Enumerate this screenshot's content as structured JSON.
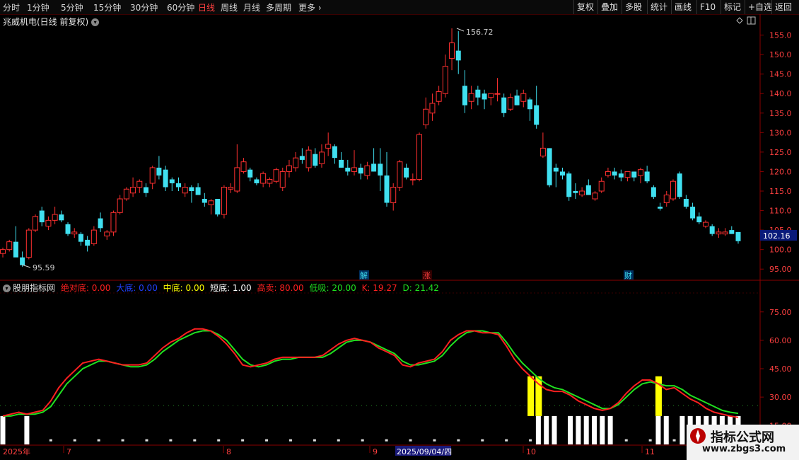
{
  "toolbar": {
    "periods": [
      "分时",
      "1分钟",
      "5分钟",
      "15分钟",
      "30分钟",
      "60分钟",
      "日线",
      "周线",
      "月线",
      "多周期",
      "更多"
    ],
    "active_period": "日线",
    "right_buttons": [
      "复权",
      "叠加",
      "多股",
      "统计",
      "画线",
      "F10",
      "标记",
      "+自选",
      "返回"
    ]
  },
  "stock": {
    "title": "兆威机电(日线 前复权)"
  },
  "price_chart": {
    "y_ticks": [
      "155.0",
      "150.0",
      "145.0",
      "140.0",
      "135.0",
      "130.0",
      "125.0",
      "120.0",
      "115.0",
      "110.0",
      "105.0",
      "100.0",
      "95.00"
    ],
    "y_range": [
      92.5,
      160
    ],
    "max_label": "156.72",
    "min_label": "95.59",
    "last_price": "102.16",
    "markers": [
      "解",
      "涨",
      "财"
    ],
    "colors": {
      "up": "#ff3030",
      "down": "#40e0f0"
    }
  },
  "indicator": {
    "name": "股朋指标网",
    "legend": [
      {
        "label": "绝对底: 0.00",
        "color": "#ff2020"
      },
      {
        "label": "大底: 0.00",
        "color": "#2040ff"
      },
      {
        "label": "中底: 0.00",
        "color": "#ffff00"
      },
      {
        "label": "短底: 1.00",
        "color": "#ffffff"
      },
      {
        "label": "高卖: 80.00",
        "color": "#ff2020"
      },
      {
        "label": "低吸: 20.00",
        "color": "#20e020"
      },
      {
        "label": "K: 19.27",
        "color": "#ff2020"
      },
      {
        "label": "D: 21.42",
        "color": "#20e020"
      }
    ],
    "y_ticks": [
      "75.00",
      "60.00",
      "45.00",
      "30.00",
      "15.00"
    ],
    "y_range": [
      5,
      85
    ],
    "k_color": "#ff2020",
    "d_color": "#20e020"
  },
  "date_axis": {
    "labels": [
      "2025年",
      "7",
      "8",
      "9",
      "10",
      "11"
    ],
    "highlight": "2025/09/04/四"
  },
  "watermark": {
    "title": "指标公式网",
    "url": "www.zbgs3.com"
  },
  "chart_data": {
    "type": "candlestick",
    "candles": [
      [
        99.0,
        100.5,
        98.0,
        100.0
      ],
      [
        100.0,
        102.5,
        99.5,
        102.0
      ],
      [
        102.0,
        106.0,
        101.5,
        98.0
      ],
      [
        98.0,
        99.5,
        95.6,
        96.0
      ],
      [
        98.0,
        105.5,
        97.5,
        105.0
      ],
      [
        105.0,
        109.0,
        104.5,
        108.5
      ],
      [
        110.0,
        111.0,
        106.0,
        107.0
      ],
      [
        106.0,
        108.5,
        105.0,
        107.5
      ],
      [
        107.5,
        111.0,
        106.5,
        109.0
      ],
      [
        109.0,
        110.0,
        107.0,
        107.5
      ],
      [
        106.5,
        107.0,
        103.5,
        104.0
      ],
      [
        104.0,
        105.5,
        103.0,
        104.5
      ],
      [
        104.0,
        104.5,
        101.0,
        102.0
      ],
      [
        102.5,
        103.5,
        99.5,
        101.0
      ],
      [
        101.5,
        106.0,
        101.0,
        105.0
      ],
      [
        108.0,
        109.5,
        104.5,
        105.5
      ],
      [
        103.5,
        105.0,
        102.5,
        104.5
      ],
      [
        104.5,
        110.0,
        103.5,
        109.5
      ],
      [
        109.5,
        114.0,
        109.0,
        113.0
      ],
      [
        113.0,
        116.0,
        112.5,
        115.5
      ],
      [
        114.5,
        118.5,
        113.5,
        116.0
      ],
      [
        116.0,
        118.0,
        114.5,
        117.5
      ],
      [
        116.0,
        117.0,
        113.5,
        114.5
      ],
      [
        117.0,
        121.5,
        115.5,
        121.0
      ],
      [
        121.0,
        124.0,
        118.0,
        119.0
      ],
      [
        120.5,
        121.5,
        115.0,
        116.0
      ],
      [
        118.0,
        118.5,
        115.0,
        117.0
      ],
      [
        117.0,
        118.5,
        115.0,
        116.0
      ],
      [
        114.5,
        117.0,
        113.5,
        116.0
      ],
      [
        116.0,
        116.5,
        112.0,
        115.0
      ],
      [
        116.0,
        117.0,
        114.5,
        114.0
      ],
      [
        113.0,
        114.5,
        111.0,
        112.0
      ],
      [
        111.5,
        113.0,
        109.0,
        112.5
      ],
      [
        113.0,
        112.5,
        108.5,
        109.0
      ],
      [
        109.0,
        116.5,
        108.0,
        116.0
      ],
      [
        115.5,
        117.0,
        114.5,
        116.0
      ],
      [
        115.0,
        127.0,
        114.5,
        121.0
      ],
      [
        120.0,
        123.5,
        119.5,
        122.5
      ],
      [
        120.5,
        121.0,
        117.5,
        118.5
      ],
      [
        118.0,
        118.5,
        116.5,
        117.0
      ],
      [
        117.0,
        120.0,
        116.0,
        119.5
      ],
      [
        117.0,
        118.5,
        116.0,
        118.0
      ],
      [
        117.5,
        121.0,
        117.0,
        120.5
      ],
      [
        116.0,
        121.0,
        115.0,
        120.0
      ],
      [
        120.0,
        123.0,
        118.5,
        121.5
      ],
      [
        121.0,
        125.0,
        120.0,
        123.5
      ],
      [
        124.0,
        126.0,
        122.0,
        123.0
      ],
      [
        121.0,
        126.5,
        120.0,
        125.5
      ],
      [
        124.5,
        126.0,
        121.0,
        121.5
      ],
      [
        122.0,
        127.0,
        121.0,
        125.0
      ],
      [
        126.0,
        130.0,
        124.0,
        127.0
      ],
      [
        126.5,
        127.0,
        122.0,
        123.5
      ],
      [
        123.0,
        125.0,
        121.0,
        121.0
      ],
      [
        121.0,
        123.0,
        119.0,
        120.0
      ],
      [
        120.0,
        125.5,
        119.0,
        121.0
      ],
      [
        121.0,
        122.0,
        118.0,
        119.5
      ],
      [
        119.0,
        122.5,
        118.0,
        121.5
      ],
      [
        122.0,
        126.0,
        120.0,
        120.0
      ],
      [
        122.0,
        126.0,
        115.0,
        119.0
      ],
      [
        119.0,
        125.0,
        111.0,
        112.0
      ],
      [
        112.0,
        117.0,
        110.0,
        116.0
      ],
      [
        116.0,
        123.0,
        115.0,
        122.5
      ],
      [
        121.0,
        122.0,
        118.0,
        118.5
      ],
      [
        118.0,
        119.5,
        116.5,
        118.0
      ],
      [
        118.0,
        130.0,
        117.5,
        129.5
      ],
      [
        132.0,
        139.0,
        131.0,
        136.0
      ],
      [
        135.0,
        140.0,
        133.0,
        137.5
      ],
      [
        138.0,
        142.0,
        137.0,
        140.5
      ],
      [
        140.0,
        150.0,
        139.0,
        147.0
      ],
      [
        149.0,
        156.72,
        146.0,
        153.0
      ],
      [
        151.0,
        156.0,
        145.0,
        148.5
      ],
      [
        142.0,
        146.0,
        135.0,
        137.0
      ],
      [
        138.0,
        142.0,
        136.0,
        140.0
      ],
      [
        141.0,
        142.0,
        137.0,
        139.0
      ],
      [
        140.0,
        141.0,
        136.0,
        138.5
      ],
      [
        139.0,
        140.0,
        137.0,
        140.0
      ],
      [
        140.0,
        144.0,
        138.0,
        140.0
      ],
      [
        139.0,
        140.0,
        134.0,
        135.0
      ],
      [
        136.0,
        140.0,
        135.5,
        139.0
      ],
      [
        139.5,
        141.0,
        137.0,
        137.0
      ],
      [
        138.0,
        141.0,
        136.5,
        140.0
      ],
      [
        138.5,
        139.0,
        133.0,
        136.0
      ],
      [
        137.0,
        142.0,
        131.0,
        132.0
      ],
      [
        124.0,
        130.0,
        123.5,
        126.0
      ],
      [
        126.0,
        126.0,
        116.0,
        116.5
      ],
      [
        121.0,
        122.0,
        116.0,
        120.0
      ],
      [
        120.0,
        121.0,
        118.0,
        119.0
      ],
      [
        119.5,
        120.0,
        112.5,
        113.5
      ],
      [
        115.0,
        117.0,
        113.0,
        114.5
      ],
      [
        114.0,
        116.0,
        113.5,
        115.0
      ],
      [
        116.5,
        118.0,
        114.0,
        114.0
      ],
      [
        113.0,
        115.0,
        112.5,
        114.5
      ],
      [
        115.0,
        118.5,
        114.5,
        117.5
      ],
      [
        119.0,
        121.0,
        118.5,
        120.0
      ],
      [
        120.0,
        121.0,
        118.0,
        119.0
      ],
      [
        119.5,
        120.5,
        117.5,
        118.5
      ],
      [
        118.5,
        120.0,
        117.5,
        120.0
      ],
      [
        120.0,
        120.0,
        117.5,
        118.5
      ],
      [
        119.0,
        121.0,
        117.0,
        120.5
      ],
      [
        120.0,
        121.5,
        117.0,
        117.5
      ],
      [
        116.0,
        116.5,
        113.0,
        113.5
      ],
      [
        111.0,
        112.0,
        110.0,
        110.5
      ],
      [
        112.0,
        115.0,
        111.0,
        114.0
      ],
      [
        113.0,
        118.0,
        112.5,
        117.5
      ],
      [
        119.5,
        120.0,
        113.0,
        113.5
      ],
      [
        113.0,
        114.0,
        110.5,
        111.0
      ],
      [
        111.0,
        112.0,
        107.5,
        108.0
      ],
      [
        108.5,
        109.5,
        106.5,
        107.0
      ],
      [
        106.0,
        107.5,
        105.5,
        107.0
      ],
      [
        106.0,
        106.5,
        103.5,
        104.0
      ],
      [
        104.0,
        105.5,
        103.0,
        104.5
      ],
      [
        104.0,
        105.5,
        103.5,
        104.5
      ],
      [
        105.0,
        106.0,
        104.0,
        104.0
      ],
      [
        104.5,
        104.5,
        101.5,
        102.16
      ]
    ],
    "k": [
      20,
      21,
      22,
      21,
      22,
      23,
      28,
      35,
      40,
      44,
      48,
      49,
      50,
      49,
      48,
      47,
      47,
      47,
      48,
      52,
      56,
      59,
      61,
      64,
      66,
      66,
      65,
      62,
      58,
      53,
      47,
      46,
      47,
      48,
      50,
      51,
      51,
      51,
      51,
      51,
      52,
      55,
      58,
      60,
      61,
      60,
      59,
      56,
      54,
      52,
      47,
      46,
      48,
      49,
      50,
      54,
      60,
      63,
      65,
      65,
      64,
      64,
      63,
      57,
      50,
      45,
      41,
      37,
      34,
      33,
      33,
      31,
      28,
      26,
      24,
      23,
      24,
      27,
      32,
      36,
      39,
      39,
      37,
      34,
      35,
      32,
      29,
      27,
      24,
      22,
      21,
      20,
      19.27
    ],
    "d": [
      20,
      20,
      21,
      21,
      21,
      22,
      25,
      31,
      37,
      41,
      45,
      47,
      49,
      49,
      48,
      47,
      46,
      46,
      47,
      50,
      54,
      57,
      60,
      62,
      64,
      65,
      65,
      63,
      60,
      55,
      50,
      47,
      46,
      47,
      49,
      50,
      50,
      51,
      51,
      51,
      51,
      53,
      56,
      59,
      60,
      60,
      59,
      57,
      55,
      53,
      49,
      47,
      47,
      48,
      49,
      52,
      57,
      61,
      64,
      65,
      65,
      64,
      64,
      59,
      53,
      48,
      44,
      40,
      37,
      35,
      34,
      32,
      30,
      28,
      26,
      24,
      24,
      26,
      30,
      34,
      37,
      38,
      37,
      36,
      36,
      34,
      31,
      29,
      27,
      25,
      23,
      22,
      21.42
    ]
  }
}
